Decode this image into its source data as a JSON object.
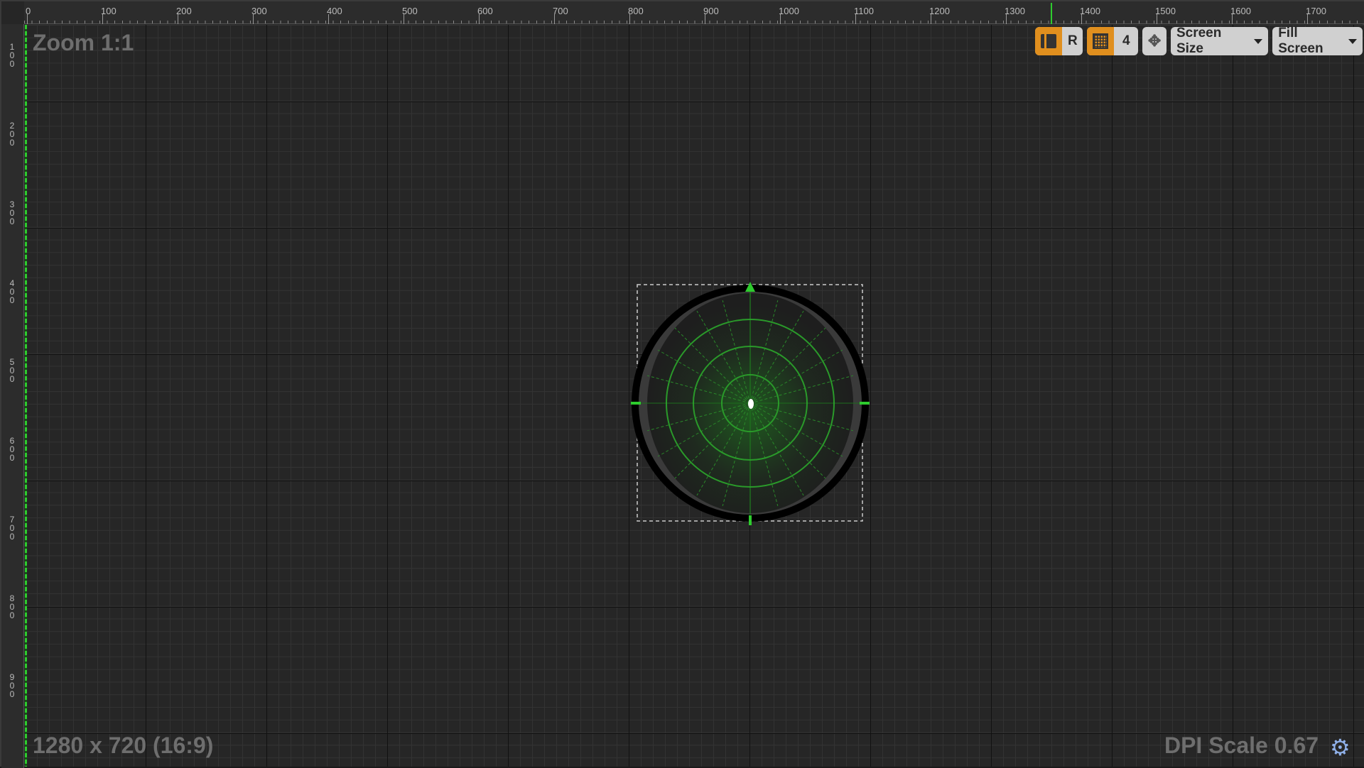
{
  "ruler": {
    "h_labels": [
      "0",
      "100",
      "200",
      "300",
      "400",
      "500",
      "600",
      "700",
      "800",
      "900",
      "1000",
      "1100",
      "1200",
      "1300",
      "1400",
      "1500",
      "1600",
      "1700"
    ],
    "v_labels": [
      "100",
      "200",
      "300",
      "400",
      "500",
      "600",
      "700",
      "800",
      "900"
    ]
  },
  "overlay": {
    "zoom": "Zoom 1:1",
    "resolution": "1280 x 720 (16:9)",
    "dpi": "DPI Scale 0.67"
  },
  "toolbar": {
    "layout_r": "R",
    "grid_snap": "4",
    "screen_size": "Screen Size",
    "fill_screen": "Fill Screen"
  },
  "colors": {
    "accent": "#e08f1e",
    "radar_green": "#2ecc2e",
    "background": "#262626"
  },
  "icons": [
    "layout-icon",
    "grid-icon",
    "transform-icon",
    "gear-icon",
    "chevron-down-icon"
  ]
}
